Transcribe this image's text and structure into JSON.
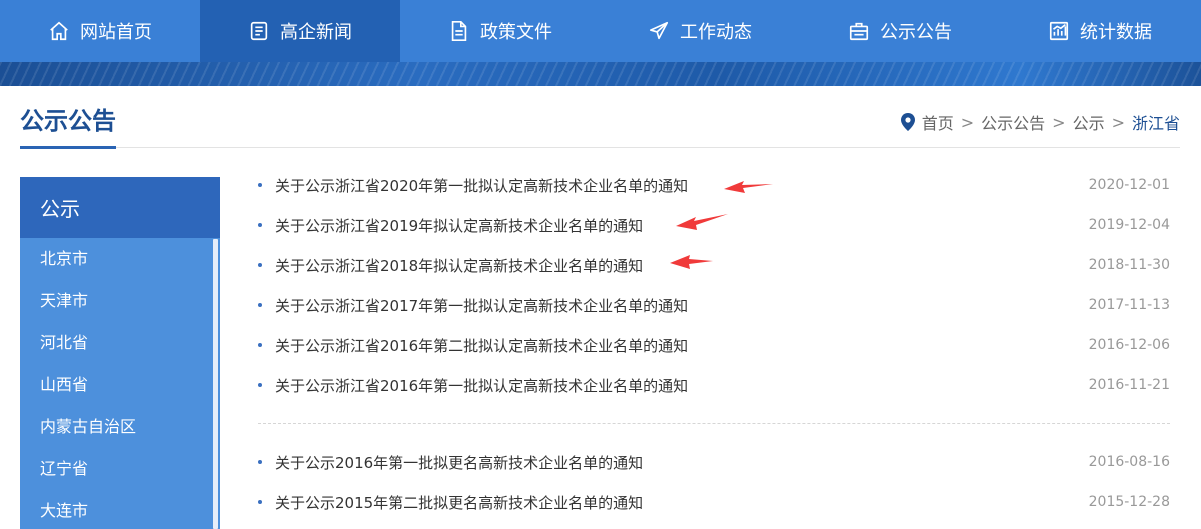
{
  "nav": {
    "items": [
      {
        "label": "网站首页",
        "icon": "home-icon",
        "active": false
      },
      {
        "label": "高企新闻",
        "icon": "news-icon",
        "active": true
      },
      {
        "label": "政策文件",
        "icon": "document-icon",
        "active": false
      },
      {
        "label": "工作动态",
        "icon": "paper-plane-icon",
        "active": false
      },
      {
        "label": "公示公告",
        "icon": "announcement-icon",
        "active": false
      },
      {
        "label": "统计数据",
        "icon": "chart-icon",
        "active": false
      }
    ]
  },
  "page": {
    "title": "公示公告",
    "breadcrumb": [
      "首页",
      "公示公告",
      "公示",
      "浙江省"
    ],
    "breadcrumb_separator": ">"
  },
  "sidebar": {
    "header": "公示",
    "items": [
      "北京市",
      "天津市",
      "河北省",
      "山西省",
      "内蒙古自治区",
      "辽宁省",
      "大连市"
    ]
  },
  "notices": {
    "group1": [
      {
        "title": "关于公示浙江省2020年第一批拟认定高新技术企业名单的通知",
        "date": "2020-12-01"
      },
      {
        "title": "关于公示浙江省2019年拟认定高新技术企业名单的通知",
        "date": "2019-12-04"
      },
      {
        "title": "关于公示浙江省2018年拟认定高新技术企业名单的通知",
        "date": "2018-11-30"
      },
      {
        "title": "关于公示浙江省2017年第一批拟认定高新技术企业名单的通知",
        "date": "2017-11-13"
      },
      {
        "title": "关于公示浙江省2016年第二批拟认定高新技术企业名单的通知",
        "date": "2016-12-06"
      },
      {
        "title": "关于公示浙江省2016年第一批拟认定高新技术企业名单的通知",
        "date": "2016-11-21"
      }
    ],
    "group2": [
      {
        "title": "关于公示2016年第一批拟更名高新技术企业名单的通知",
        "date": "2016-08-16"
      },
      {
        "title": "关于公示2015年第二批拟更名高新技术企业名单的通知",
        "date": "2015-12-28"
      }
    ]
  },
  "colors": {
    "nav_bg": "#3a80d6",
    "nav_active": "#2361b3",
    "sidebar_bg": "#4d90dc",
    "sidebar_header": "#2e67bb",
    "title_blue": "#1d4f93",
    "annotation_arrow": "#f03a3a"
  }
}
